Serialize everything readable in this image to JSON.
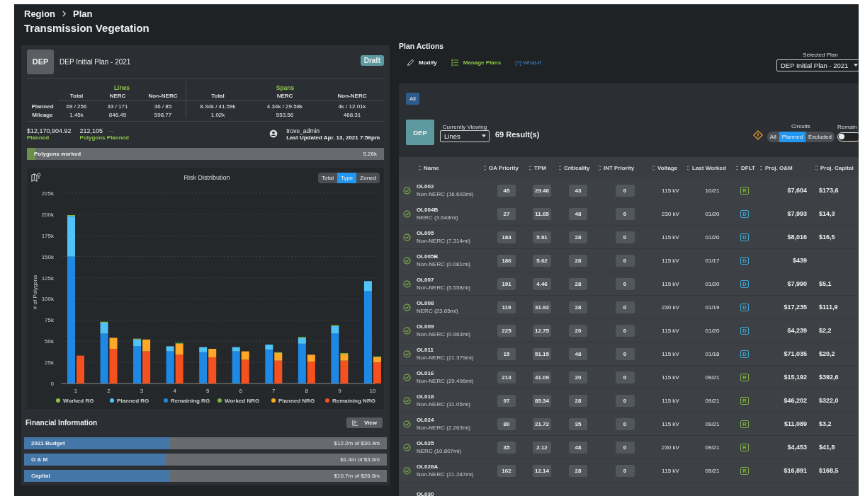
{
  "breadcrumb": [
    "Region",
    "Plan"
  ],
  "page_title": "Transmission Vegetation",
  "plan_card": {
    "badge": "DEP",
    "name": "DEP Initial Plan - 2021",
    "status": "Draft",
    "groups": [
      {
        "title": "Lines",
        "columns": [
          "Total",
          "NERC",
          "Non-NERC"
        ]
      },
      {
        "title": "Spans",
        "columns": [
          "Total",
          "NERC",
          "Non-NERC"
        ]
      }
    ],
    "rows": [
      {
        "label": "Planned",
        "values": [
          "69 / 256",
          "33 / 171",
          "36 / 85",
          "8.34k / 41.59k",
          "4.34k / 29.58k",
          "4k / 12.01k"
        ]
      },
      {
        "label": "Mileage",
        "values": [
          "1.45k",
          "846.45",
          "598.77",
          "1.02k",
          "553.56",
          "468.31"
        ]
      }
    ],
    "planned_amount": "$12,170,904.92",
    "planned_label": "Planned",
    "polygons": "212,105",
    "trend": "—",
    "polygons_label": "Polygons Planned",
    "user": "trove_admin",
    "last_updated": "Last Updated Apr. 13, 2021 7:56pm",
    "progress": {
      "label": "Polygons worked",
      "value": "5.26k",
      "level": 0.024
    }
  },
  "risk_chart": {
    "title": "Risk Distribution",
    "toggle": [
      {
        "label": "Total",
        "selected": false
      },
      {
        "label": "Type",
        "selected": true
      },
      {
        "label": "Zoned",
        "selected": false
      }
    ],
    "rg_bars": {
      "chart_data": {
        "type": "bar",
        "stacked": true,
        "grid": true,
        "legend": "bottom",
        "ylabel": "# of Polygons",
        "categories": [
          "1",
          "2",
          "3",
          "4",
          "5",
          "6",
          "7",
          "8",
          "9",
          "10"
        ],
        "ylim": [
          0,
          225000
        ],
        "yticks": [
          {
            "value": 0,
            "label": "0"
          },
          {
            "value": 25000,
            "label": "25k"
          },
          {
            "value": 50000,
            "label": "50k"
          },
          {
            "value": 75000,
            "label": "75k"
          },
          {
            "value": 100000,
            "label": "100k"
          },
          {
            "value": 125000,
            "label": "125k"
          },
          {
            "value": 150000,
            "label": "150k"
          },
          {
            "value": 175000,
            "label": "175k"
          },
          {
            "value": 200000,
            "label": "200k"
          },
          {
            "value": 225000,
            "label": "225k"
          }
        ],
        "series": [
          {
            "name": "Worked RG",
            "color": "#8bc34a",
            "values": [
              1000,
              1000,
              1000,
              0,
              0,
              0,
              0,
              1000,
              1000,
              0
            ]
          },
          {
            "name": "Planned RG",
            "color": "#4fc3f7",
            "values": [
              48000,
              13000,
              8000,
              6000,
              6000,
              5000,
              6000,
              7000,
              9000,
              12000
            ]
          },
          {
            "name": "Remaining RG",
            "color": "#1e88e5",
            "values": [
              150000,
              59000,
              44000,
              38000,
              37000,
              38000,
              40000,
              47000,
              59000,
              109000
            ]
          }
        ]
      }
    },
    "nrg_bars": {
      "chart_data": {
        "type": "bar",
        "stacked": true,
        "legend": "bottom",
        "ylim": [
          0,
          225000
        ],
        "series": [
          {
            "name": "Worked NRG",
            "color": "#7cb342",
            "values": [
              0,
              0,
              0,
              1000,
              0,
              0,
              1000,
              0,
              1000,
              1000
            ]
          },
          {
            "name": "Planned NRG",
            "color": "#ffa726",
            "values": [
              0,
              13000,
              14000,
              13000,
              10000,
              10000,
              9000,
              8000,
              8000,
              6000
            ]
          },
          {
            "name": "Remaining NRG",
            "color": "#f4511e",
            "values": [
              33000,
              41000,
              38000,
              34000,
              31000,
              28000,
              27000,
              26000,
              27000,
              25000
            ]
          }
        ]
      }
    }
  },
  "financial": {
    "title": "Financial Information",
    "button": "View",
    "bars": [
      {
        "label": "2021 Budget",
        "value": "$12.2m of $30.4m",
        "level": 0.4
      },
      {
        "label": "O & M",
        "value": "$1.4m of $3.6m",
        "level": 0.39
      },
      {
        "label": "Capital",
        "value": "$10.7m of $26.8m",
        "level": 0.4
      }
    ]
  },
  "plan_actions": {
    "title": "Plan Actions",
    "actions": [
      {
        "label": "Modify",
        "kind": "edit"
      },
      {
        "label": "Manage Plans",
        "kind": "list"
      },
      {
        "label": "[?] What-If",
        "kind": "link"
      }
    ],
    "selected_plan": {
      "label": "Selected Plan",
      "value": "DEP Initial Plan - 2021"
    }
  },
  "results": {
    "filter": {
      "label": "All",
      "selected": true
    },
    "badge": "DEP",
    "viewing": {
      "label": "Currently Viewing",
      "value": "Lines"
    },
    "count": "69 Result(s)",
    "circuits": {
      "label": "Circuits",
      "options": [
        {
          "label": "All",
          "selected": false
        },
        {
          "label": "Planned",
          "selected": true
        },
        {
          "label": "Excluded",
          "selected": false
        }
      ]
    },
    "remaining": {
      "label": "Remain",
      "on": false
    },
    "table": {
      "columns": [
        "Name",
        "OA Priority",
        "TPM",
        "Criticality",
        "INT Priority",
        "Voltage",
        "Last Worked",
        "DFLT",
        "Proj. O&M",
        "Proj. Capital"
      ],
      "rows": [
        {
          "name": "OL002",
          "detail": "Non-NERC (16.692mi)",
          "oa_priority": "45",
          "tpm": "29.46",
          "criticality": "43",
          "int_priority": "0",
          "voltage": "115 kV",
          "last_worked": "10/21",
          "dflt": "R",
          "color": "#7cb342",
          "proj_om": "$7,604",
          "proj_capital": "$173,6"
        },
        {
          "name": "OL004B",
          "detail": "NERC (3.648mi)",
          "oa_priority": "27",
          "tpm": "11.65",
          "criticality": "48",
          "int_priority": "0",
          "voltage": "230 kV",
          "last_worked": "01/20",
          "dflt": "D",
          "color": "#3fa9d6",
          "proj_om": "$7,993",
          "proj_capital": "$14,3"
        },
        {
          "name": "OL005",
          "detail": "Non-NERC (7.314mi)",
          "oa_priority": "184",
          "tpm": "5.91",
          "criticality": "28",
          "int_priority": "0",
          "voltage": "115 kV",
          "last_worked": "01/20",
          "dflt": "D",
          "color": "#3fa9d6",
          "proj_om": "$8,016",
          "proj_capital": "$16,5"
        },
        {
          "name": "OL005B",
          "detail": "Non-NERC (0.081mi)",
          "oa_priority": "186",
          "tpm": "5.62",
          "criticality": "28",
          "int_priority": "0",
          "voltage": "115 kV",
          "last_worked": "01/17",
          "dflt": "D",
          "color": "#3fa9d6",
          "proj_om": "$439"
        },
        {
          "name": "OL007",
          "detail": "Non-NERC (5.558mi)",
          "oa_priority": "191",
          "tpm": "4.46",
          "criticality": "28",
          "int_priority": "0",
          "voltage": "115 kV",
          "last_worked": "01/20",
          "dflt": "D",
          "color": "#3fa9d6",
          "proj_om": "$7,990",
          "proj_capital": "$5,1"
        },
        {
          "name": "OL008",
          "detail": "NERC (23.65mi)",
          "oa_priority": "119",
          "tpm": "31.92",
          "criticality": "28",
          "int_priority": "0",
          "voltage": "230 kV",
          "last_worked": "01/19",
          "dflt": "D",
          "color": "#3fa9d6",
          "proj_om": "$17,235",
          "proj_capital": "$111,9"
        },
        {
          "name": "OL009",
          "detail": "Non-NERC (0.963mi)",
          "oa_priority": "225",
          "tpm": "12.75",
          "criticality": "20",
          "int_priority": "0",
          "voltage": "115 kV",
          "last_worked": "01/20",
          "dflt": "D",
          "color": "#3fa9d6",
          "proj_om": "$4,239",
          "proj_capital": "$2,2"
        },
        {
          "name": "OL011",
          "detail": "Non-NERC (21.379mi)",
          "oa_priority": "15",
          "tpm": "51.15",
          "criticality": "48",
          "int_priority": "0",
          "voltage": "115 kV",
          "last_worked": "01/18",
          "dflt": "D",
          "color": "#3fa9d6",
          "proj_om": "$71,035",
          "proj_capital": "$20,2"
        },
        {
          "name": "OL016",
          "detail": "Non-NERC (29.496mi)",
          "oa_priority": "213",
          "tpm": "41.09",
          "criticality": "20",
          "int_priority": "0",
          "voltage": "115 kV",
          "last_worked": "09/21",
          "dflt": "R",
          "color": "#7cb342",
          "proj_om": "$15,192",
          "proj_capital": "$392,6"
        },
        {
          "name": "OL018",
          "detail": "Non-NERC (31.05mi)",
          "oa_priority": "97",
          "tpm": "85.34",
          "criticality": "28",
          "int_priority": "0",
          "voltage": "115 kV",
          "last_worked": "09/21",
          "dflt": "R",
          "color": "#7cb342",
          "proj_om": "$46,202",
          "proj_capital": "$322,0"
        },
        {
          "name": "OL024",
          "detail": "Non-NERC (2.263mi)",
          "oa_priority": "80",
          "tpm": "21.72",
          "criticality": "35",
          "int_priority": "0",
          "voltage": "115 kV",
          "last_worked": "09/21",
          "dflt": "R",
          "color": "#7cb342",
          "proj_om": "$11,089",
          "proj_capital": "$3,2"
        },
        {
          "name": "OL025",
          "detail": "NERC (10.807mi)",
          "oa_priority": "35",
          "tpm": "2.12",
          "criticality": "48",
          "int_priority": "0",
          "voltage": "230 kV",
          "last_worked": "09/21",
          "dflt": "R",
          "color": "#7cb342",
          "proj_om": "$4,453",
          "proj_capital": "$41,8"
        },
        {
          "name": "OL028A",
          "detail": "Non-NERC (21.287mi)",
          "oa_priority": "162",
          "tpm": "12.14",
          "criticality": "28",
          "int_priority": "0",
          "voltage": "115 kV",
          "last_worked": "09/21",
          "dflt": "R",
          "color": "#7cb342",
          "proj_om": "$16,891",
          "proj_capital": "$168,5"
        },
        {
          "name": "OL030"
        }
      ]
    }
  }
}
